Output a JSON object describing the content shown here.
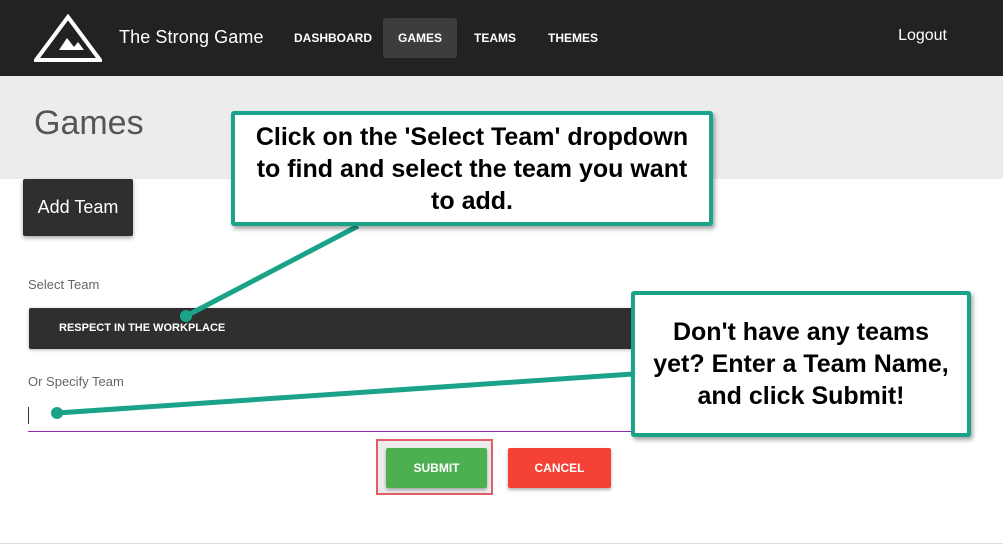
{
  "navbar": {
    "brand": "The Strong Game",
    "items": [
      {
        "label": "DASHBOARD",
        "active": false
      },
      {
        "label": "GAMES",
        "active": true
      },
      {
        "label": "TEAMS",
        "active": false
      },
      {
        "label": "THEMES",
        "active": false
      }
    ],
    "logout": "Logout"
  },
  "page": {
    "title": "Games",
    "add_team_label": "Add Team"
  },
  "form": {
    "select_label": "Select Team",
    "selected_team": "RESPECT IN THE WORKPLACE",
    "specify_label": "Or Specify Team",
    "specify_value": "",
    "submit_label": "SUBMIT",
    "cancel_label": "CANCEL"
  },
  "callouts": {
    "select_help": "Click on the 'Select Team' dropdown to find and select the team you want to add.",
    "no_teams_help": "Don't have any teams yet?  Enter a Team Name, and click Submit!"
  },
  "colors": {
    "navbar": "#222222",
    "callout_border": "#1aa389",
    "submit": "#4caf50",
    "cancel": "#f44336",
    "input_underline": "#9c27b0",
    "highlight": "#e35d67"
  },
  "icons": {
    "logo": "mountain-triangle-logo"
  }
}
